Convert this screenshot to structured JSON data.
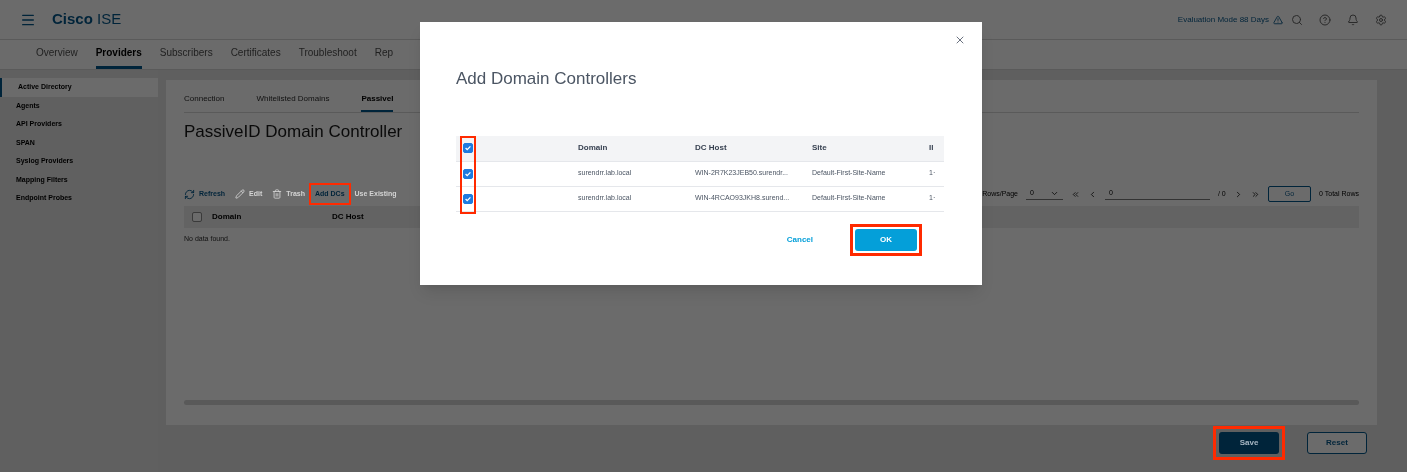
{
  "header": {
    "brand": "Cisco",
    "product": "ISE",
    "evaluation": "Evaluation Mode 88 Days"
  },
  "nav_tabs": [
    {
      "label": "Overview",
      "selected": false
    },
    {
      "label": "Providers",
      "selected": true
    },
    {
      "label": "Subscribers",
      "selected": false
    },
    {
      "label": "Certificates",
      "selected": false
    },
    {
      "label": "Troubleshoot",
      "selected": false
    },
    {
      "label": "Rep",
      "selected": false
    }
  ],
  "sidebar": {
    "items": [
      {
        "label": "Active Directory",
        "selected": true
      },
      {
        "label": "Agents",
        "selected": false
      },
      {
        "label": "API Providers",
        "selected": false
      },
      {
        "label": "SPAN",
        "selected": false
      },
      {
        "label": "Syslog Providers",
        "selected": false
      },
      {
        "label": "Mapping Filters",
        "selected": false
      },
      {
        "label": "Endpoint Probes",
        "selected": false
      }
    ]
  },
  "sub_tabs": [
    {
      "label": "Connection",
      "selected": false
    },
    {
      "label": "Whitelisted Domains",
      "selected": false
    },
    {
      "label": "PassiveI",
      "selected": true
    }
  ],
  "page_title": "PassiveID Domain Controller",
  "toolbar": [
    {
      "label": "Refresh",
      "kind": "refresh",
      "disabled": false,
      "highlighted": false
    },
    {
      "label": "Edit",
      "kind": "edit",
      "disabled": true,
      "highlighted": false
    },
    {
      "label": "Trash",
      "kind": "trash",
      "disabled": true,
      "highlighted": false
    },
    {
      "label": "Add DCs",
      "kind": "plain",
      "disabled": false,
      "highlighted": true
    },
    {
      "label": "Use Existing",
      "kind": "plain",
      "disabled": true,
      "highlighted": false
    }
  ],
  "table": {
    "select_all": {
      "checked": false
    },
    "columns": [
      "Domain",
      "DC Host"
    ],
    "empty_message": "No data found."
  },
  "pagination": {
    "rows_per_page_label": "Rows/Page",
    "rows_per_page": "0",
    "page": "0",
    "page_count": "/ 0",
    "go": "Go",
    "total": "0 Total Rows"
  },
  "footer_buttons": [
    {
      "label": "Save",
      "kind": "primary",
      "highlighted": true
    },
    {
      "label": "Reset",
      "kind": "secondary",
      "highlighted": false
    }
  ],
  "dialog": {
    "title": "Add Domain Controllers",
    "checkbox_column_highlighted": true,
    "select_all": {
      "checked": true
    },
    "columns": [
      "Domain",
      "DC Host",
      "Site",
      "Il"
    ],
    "rows": [
      {
        "checked": true,
        "domain": "surendrr.lab.local",
        "dc_host": "WIN-2R7K23JEB50.surendr...",
        "site": "Default-First-Site-Name",
        "column_4": "1·"
      },
      {
        "checked": true,
        "domain": "surendrr.lab.local",
        "dc_host": "WIN-4RCAO93JKH8.surend...",
        "site": "Default-First-Site-Name",
        "column_4": "1·"
      }
    ],
    "buttons": [
      {
        "label": "Cancel",
        "kind": "link",
        "highlighted": false
      },
      {
        "label": "OK",
        "kind": "primary",
        "highlighted": true
      }
    ]
  }
}
